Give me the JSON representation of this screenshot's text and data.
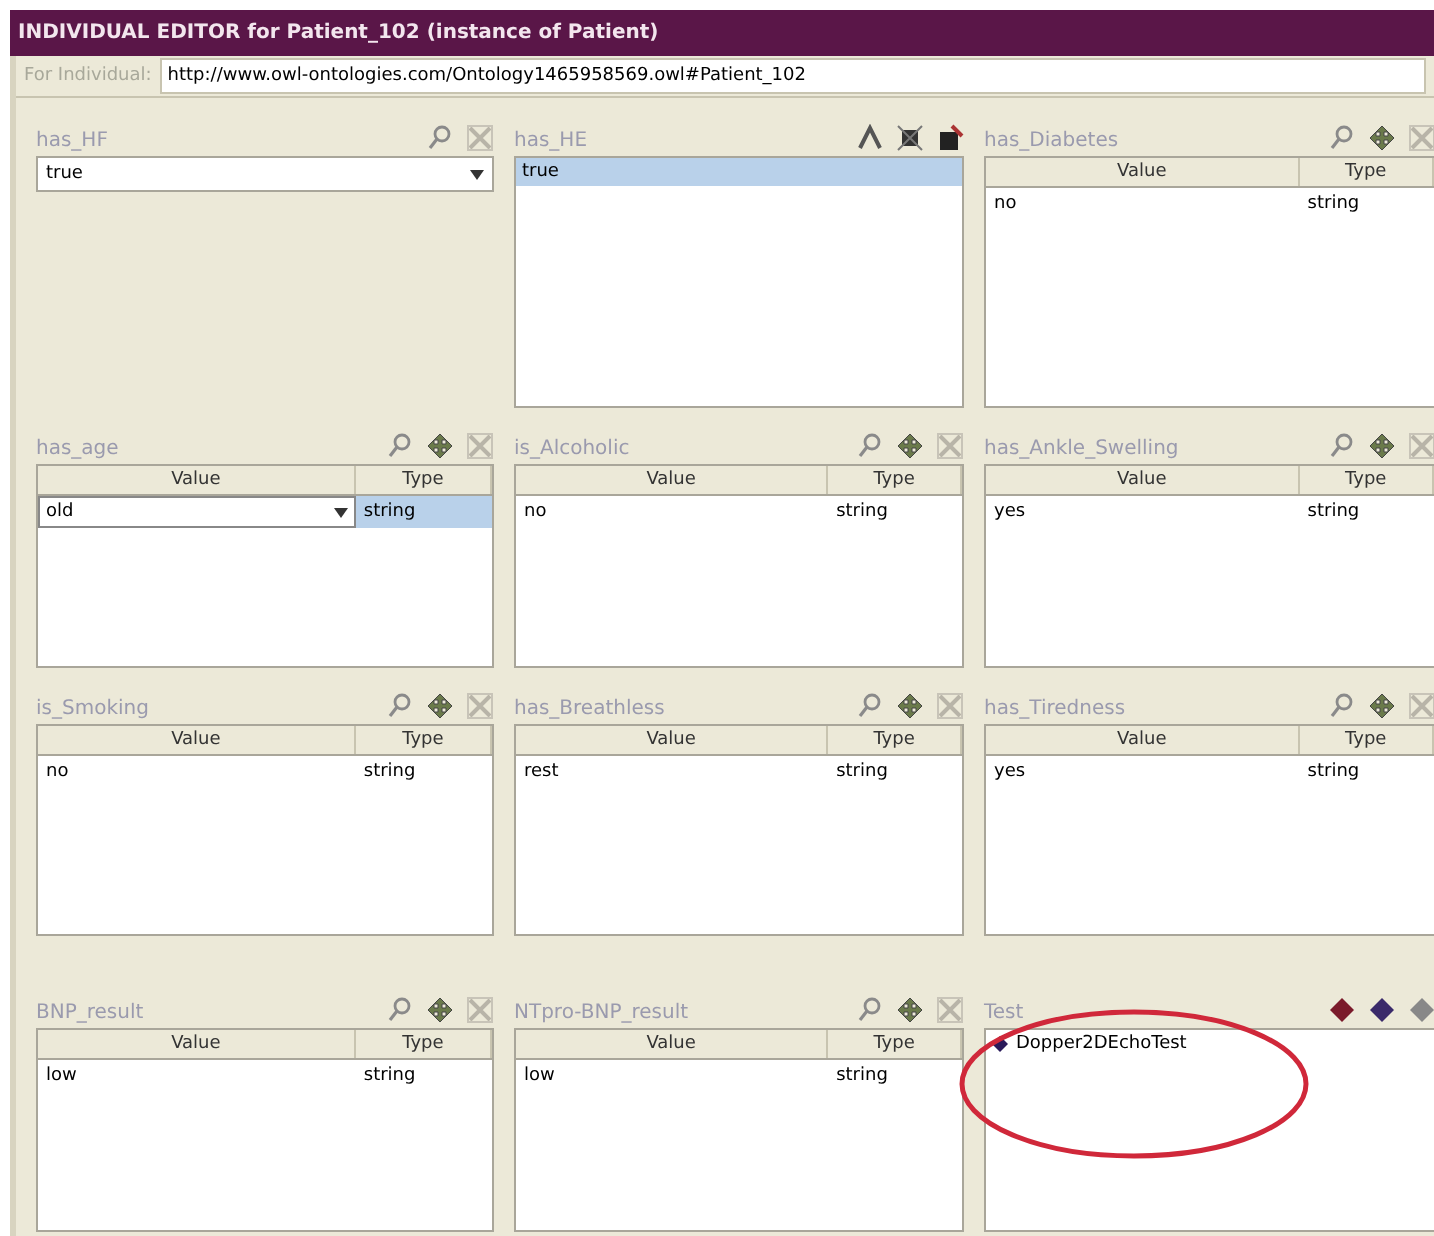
{
  "window": {
    "title": "INDIVIDUAL EDITOR for Patient_102  (instance of Patient)"
  },
  "individual": {
    "label": "For Individual:",
    "value": "http://www.owl-ontologies.com/Ontology1465958569.owl#Patient_102"
  },
  "panels": [
    {
      "kind": "combo",
      "label": "has_HF",
      "value": "true"
    },
    {
      "kind": "list",
      "label": "has_HE",
      "items": [
        {
          "text": "true",
          "selected": true
        }
      ]
    },
    {
      "kind": "table",
      "label": "has_Diabetes",
      "columns": [
        "Value",
        "Type"
      ],
      "rows": [
        {
          "value": "no",
          "type": "string",
          "selected": false
        }
      ]
    },
    {
      "kind": "table",
      "label": "has_age",
      "columns": [
        "Value",
        "Type"
      ],
      "rows": [
        {
          "value": "old",
          "type": "string",
          "selected": true
        }
      ]
    },
    {
      "kind": "table",
      "label": "is_Alcoholic",
      "columns": [
        "Value",
        "Type"
      ],
      "rows": [
        {
          "value": "no",
          "type": "string",
          "selected": false
        }
      ]
    },
    {
      "kind": "table",
      "label": "has_Ankle_Swelling",
      "columns": [
        "Value",
        "Type"
      ],
      "rows": [
        {
          "value": "yes",
          "type": "string",
          "selected": false
        }
      ]
    },
    {
      "kind": "table",
      "label": "is_Smoking",
      "columns": [
        "Value",
        "Type"
      ],
      "rows": [
        {
          "value": "no",
          "type": "string",
          "selected": false
        }
      ]
    },
    {
      "kind": "table",
      "label": "has_Breathless",
      "columns": [
        "Value",
        "Type"
      ],
      "rows": [
        {
          "value": "rest",
          "type": "string",
          "selected": false
        }
      ]
    },
    {
      "kind": "table",
      "label": "has_Tiredness",
      "columns": [
        "Value",
        "Type"
      ],
      "rows": [
        {
          "value": "yes",
          "type": "string",
          "selected": false
        }
      ]
    },
    {
      "kind": "table",
      "label": "BNP_result",
      "columns": [
        "Value",
        "Type"
      ],
      "rows": [
        {
          "value": "low",
          "type": "string",
          "selected": false
        }
      ]
    },
    {
      "kind": "table",
      "label": "NTpro-BNP_result",
      "columns": [
        "Value",
        "Type"
      ],
      "rows": [
        {
          "value": "low",
          "type": "string",
          "selected": false
        }
      ]
    },
    {
      "kind": "instances",
      "label": "Test",
      "items": [
        {
          "text": "Dopper2DEchoTest",
          "selected": false
        }
      ]
    }
  ]
}
